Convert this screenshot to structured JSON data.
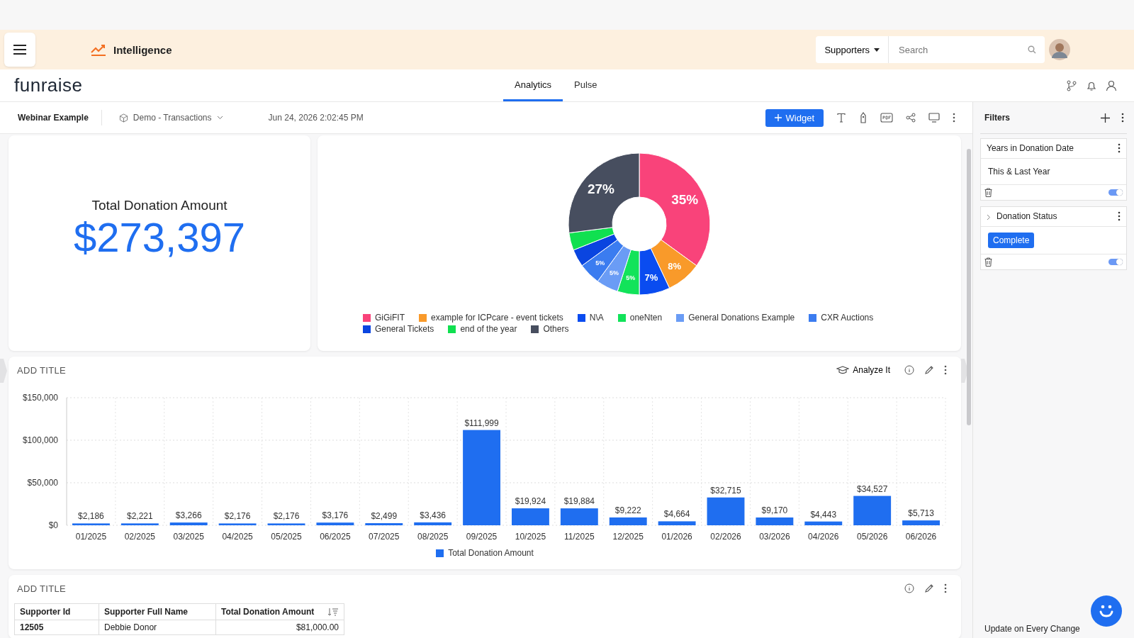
{
  "header": {
    "section": "Intelligence",
    "search_scope": "Supporters",
    "search": {
      "placeholder": "Search"
    }
  },
  "nav": {
    "logo": "funraise",
    "tabs": [
      {
        "label": "Analytics",
        "selected": true
      },
      {
        "label": "Pulse",
        "selected": false
      }
    ]
  },
  "toolbar": {
    "dashboard": "Webinar Example",
    "datasource": "Demo - Transactions",
    "timestamp": "Jun 24, 2026 2:02:45 PM",
    "widget_button": "Widget"
  },
  "kpi": {
    "title": "Total Donation Amount",
    "value": "$273,397"
  },
  "pie": {
    "chart_data": {
      "type": "donut",
      "categories": [
        "GiGiFIT",
        "example for ICPcare - event tickets",
        "N\\A",
        "oneNten",
        "General Donations Example",
        "CXR Auctions",
        "General Tickets",
        "end of the year",
        "Others"
      ],
      "series": [
        {
          "colors": [
            "#f9437a",
            "#f99a2a",
            "#0a4cf0",
            "#12e35a",
            "#6a9cf5",
            "#3b7cf0",
            "#0a45e0",
            "#10e050",
            "#474e5f"
          ],
          "values": [
            35,
            8,
            7,
            5,
            5,
            5,
            4,
            4,
            27
          ]
        }
      ],
      "value_labels": [
        "35%",
        "8%",
        "7%",
        "5%",
        "5%",
        "5%",
        null,
        null,
        "27%"
      ]
    }
  },
  "bar": {
    "title": "ADD TITLE",
    "analyze": "Analyze It",
    "chart_data": {
      "type": "bar",
      "categories": [
        "01/2025",
        "02/2025",
        "03/2025",
        "04/2025",
        "05/2025",
        "06/2025",
        "07/2025",
        "08/2025",
        "09/2025",
        "10/2025",
        "11/2025",
        "12/2025",
        "01/2026",
        "02/2026",
        "03/2026",
        "04/2026",
        "05/2026",
        "06/2026"
      ],
      "series": [
        {
          "name": "Total Donation Amount",
          "color": "#1f6ef0",
          "values": [
            2186,
            2221,
            3266,
            2176,
            2176,
            3176,
            2499,
            3436,
            111999,
            19924,
            19884,
            9222,
            4664,
            32715,
            9170,
            4443,
            34527,
            5713
          ]
        }
      ],
      "ylim": [
        0,
        150000
      ],
      "yticks": [
        {
          "value": 0,
          "label": "$0"
        },
        {
          "value": 50000,
          "label": "$50,000"
        },
        {
          "value": 100000,
          "label": "$100,000"
        },
        {
          "value": 150000,
          "label": "$150,000"
        }
      ],
      "value_labels": [
        "$2,186",
        "$2,221",
        "$3,266",
        "$2,176",
        "$2,176",
        "$3,176",
        "$2,499",
        "$3,436",
        "$111,999",
        "$19,924",
        "$19,884",
        "$9,222",
        "$4,664",
        "$32,715",
        "$9,170",
        "$4,443",
        "$34,527",
        "$5,713"
      ]
    }
  },
  "table": {
    "title": "ADD TITLE",
    "columns": [
      "Supporter Id",
      "Supporter Full Name",
      "Total Donation Amount"
    ],
    "rows": [
      [
        "12505",
        "Debbie Donor",
        "$81,000.00"
      ]
    ]
  },
  "filters": {
    "title": "Filters",
    "items": [
      {
        "name": "Years in Donation Date",
        "value": "This & Last Year",
        "kind": "text",
        "on": true
      },
      {
        "name": "Donation Status",
        "value": "Complete",
        "kind": "chip",
        "on": true
      }
    ],
    "footer": "Update on Every Change"
  }
}
